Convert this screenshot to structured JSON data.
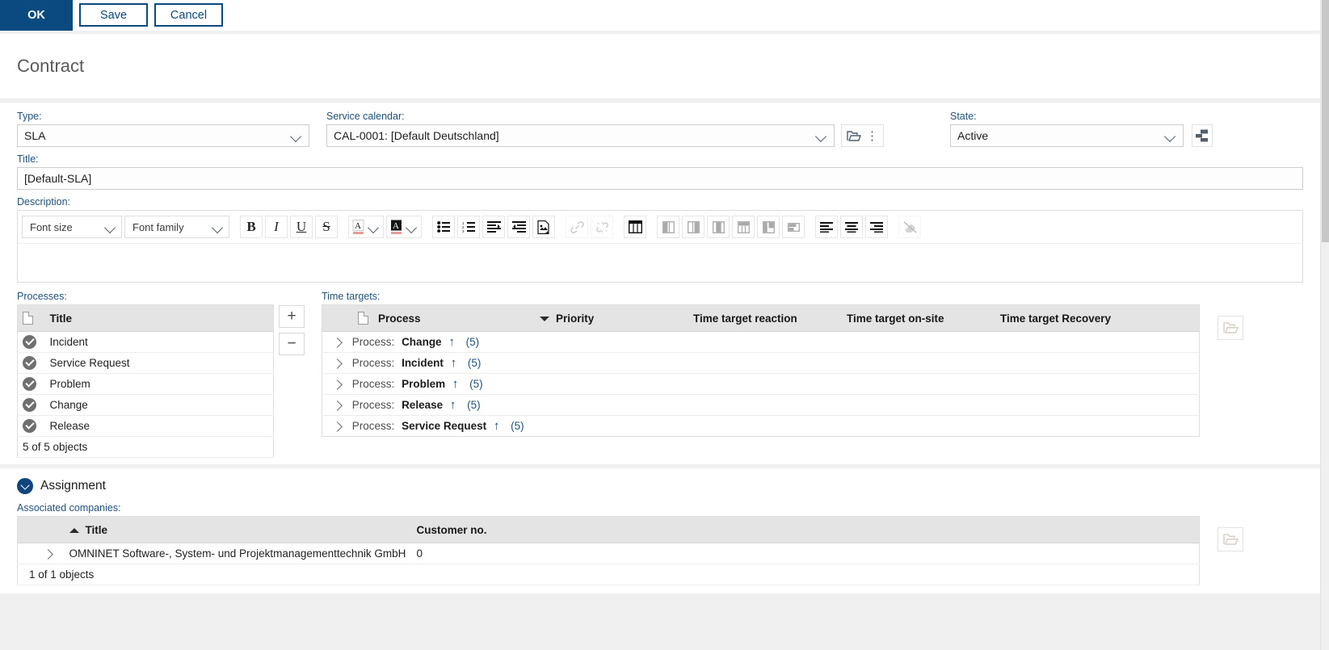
{
  "toolbar": {
    "ok_label": "OK",
    "save_label": "Save",
    "cancel_label": "Cancel"
  },
  "header": {
    "title": "Contract"
  },
  "form": {
    "type": {
      "label": "Type:",
      "value": "SLA"
    },
    "service_calendar": {
      "label": "Service calendar:",
      "value": "CAL-0001: [Default Deutschland]"
    },
    "state": {
      "label": "State:",
      "value": "Active"
    },
    "title": {
      "label": "Title:",
      "value": "[Default-SLA]"
    },
    "description": {
      "label": "Description:",
      "value": ""
    }
  },
  "editor": {
    "font_size": "Font size",
    "font_family": "Font family",
    "buttons": [
      "bold",
      "italic",
      "underline",
      "strikethrough",
      "text-color",
      "highlight-color",
      "bullet-list",
      "numbered-list",
      "indent",
      "outdent",
      "insert-image",
      "insert-link",
      "remove-link",
      "insert-table",
      "insert-column-left",
      "insert-column-right",
      "delete-column",
      "insert-row",
      "merge-cells",
      "split-cell",
      "align-left",
      "align-center",
      "align-right",
      "clear-formatting"
    ]
  },
  "processes": {
    "label": "Processes:",
    "columns": [
      "Title"
    ],
    "rows": [
      {
        "title": "Incident"
      },
      {
        "title": "Service Request"
      },
      {
        "title": "Problem"
      },
      {
        "title": "Change"
      },
      {
        "title": "Release"
      }
    ],
    "footer": "5 of 5 objects",
    "add_label": "+",
    "remove_label": "−"
  },
  "time_targets": {
    "label": "Time targets:",
    "columns": [
      "Process",
      "Priority",
      "Time target reaction",
      "Time target on-site",
      "Time target Recovery"
    ],
    "sorted_column": "Priority",
    "sort_direction": "desc",
    "groups": [
      {
        "prefix": "Process:",
        "name": "Change",
        "count": "(5)"
      },
      {
        "prefix": "Process:",
        "name": "Incident",
        "count": "(5)"
      },
      {
        "prefix": "Process:",
        "name": "Problem",
        "count": "(5)"
      },
      {
        "prefix": "Process:",
        "name": "Release",
        "count": "(5)"
      },
      {
        "prefix": "Process:",
        "name": "Service Request",
        "count": "(5)"
      }
    ]
  },
  "assignment": {
    "section_title": "Assignment",
    "associated_companies_label": "Associated companies:",
    "columns": [
      "Title",
      "Customer no."
    ],
    "sorted_column": "Title",
    "sort_direction": "asc",
    "rows": [
      {
        "title": "OMNINET Software-, System- und Projektmanagementtechnik GmbH",
        "customer_no": "0"
      }
    ],
    "footer": "1 of 1 objects"
  },
  "colors": {
    "primary": "#0b4a80",
    "link": "#158f96",
    "label": "#21527d",
    "header_bg": "#e4e4e4"
  }
}
